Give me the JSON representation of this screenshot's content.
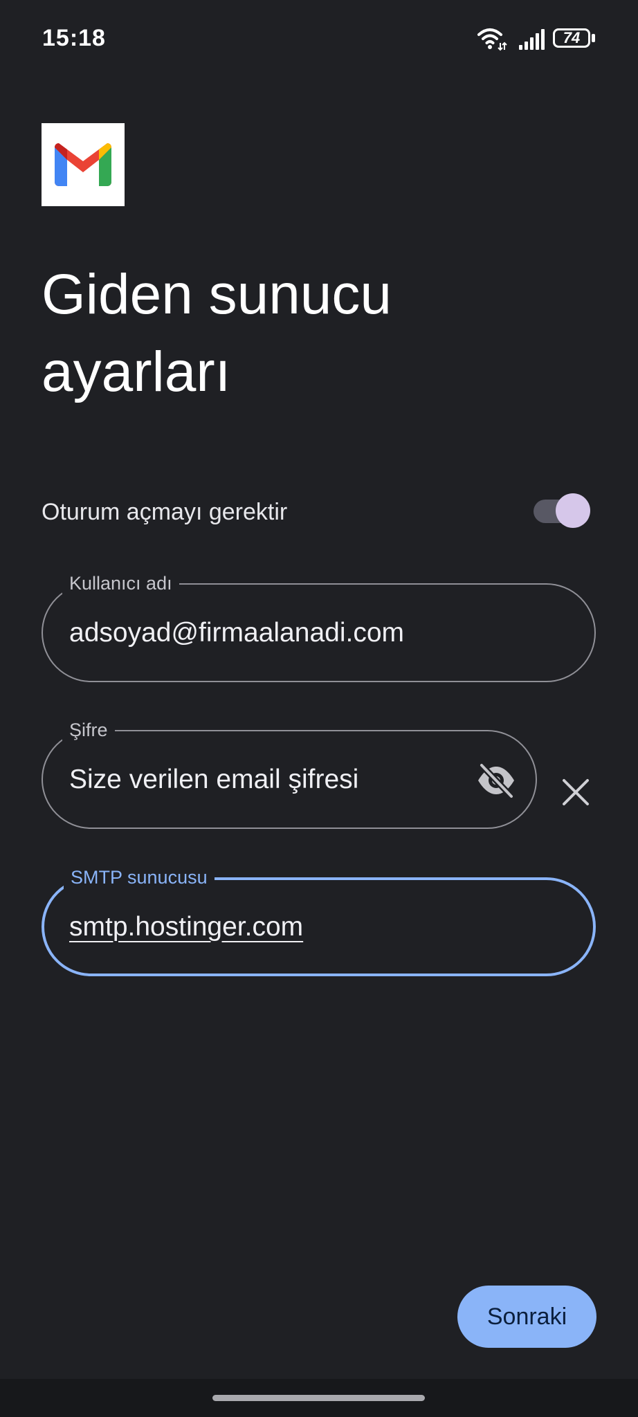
{
  "status_bar": {
    "time": "15:18",
    "battery_level": "74",
    "icons": [
      "wifi-icon",
      "signal-icon",
      "battery-icon"
    ]
  },
  "app": {
    "logo_icon": "gmail-logo"
  },
  "page": {
    "title": "Giden sunucu ayarları"
  },
  "auth": {
    "label": "Oturum açmayı gerektir",
    "enabled": true
  },
  "fields": {
    "username": {
      "label": "Kullanıcı adı",
      "value": "adsoyad@firmaalanadi.com"
    },
    "password": {
      "label": "Şifre",
      "value": "Size verilen email şifresi",
      "visibility_icon": "visibility-off-icon",
      "clear_icon": "close-icon"
    },
    "smtp": {
      "label": "SMTP sunucusu",
      "value": "smtp.hostinger.com",
      "focused": true
    }
  },
  "actions": {
    "next_label": "Sonraki"
  },
  "colors": {
    "background": "#1f2024",
    "accent": "#8ab4f8",
    "toggle_thumb": "#d6c7ea",
    "outline": "#909097"
  }
}
